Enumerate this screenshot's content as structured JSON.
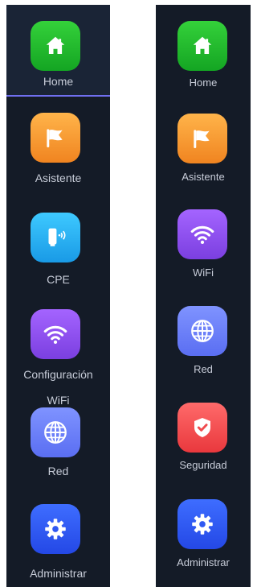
{
  "sidebar_left": {
    "items": [
      {
        "label": "Home",
        "icon": "home-icon",
        "color": "#1fba2c",
        "active": true
      },
      {
        "label": "Asistente",
        "icon": "flag-icon",
        "color": "#f59a30"
      },
      {
        "label": "CPE",
        "icon": "cpe-device-icon",
        "color": "#27b0f5"
      },
      {
        "label_line1": "Configuración",
        "label_line2": "WiFi",
        "icon": "wifi-icon",
        "color": "#8c4ff0"
      },
      {
        "label": "Red",
        "icon": "globe-icon",
        "color": "#6c80fa"
      },
      {
        "label": "Administrar",
        "icon": "gear-icon",
        "color": "#2f58f2"
      }
    ]
  },
  "sidebar_right": {
    "items": [
      {
        "label": "Home",
        "icon": "home-icon",
        "color": "#1fba2c"
      },
      {
        "label": "Asistente",
        "icon": "flag-icon",
        "color": "#f59a30"
      },
      {
        "label": "WiFi",
        "icon": "wifi-icon",
        "color": "#8c4ff0"
      },
      {
        "label": "Red",
        "icon": "globe-icon",
        "color": "#6c80fa"
      },
      {
        "label": "Seguridad",
        "icon": "shield-check-icon",
        "color": "#f04a4e"
      },
      {
        "label": "Administrar",
        "icon": "gear-icon",
        "color": "#2f58f2"
      }
    ]
  }
}
